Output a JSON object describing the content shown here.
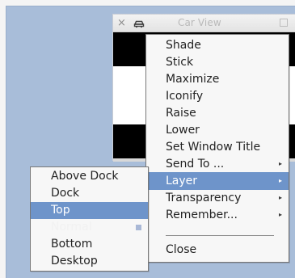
{
  "background_window": {
    "title": "Car View",
    "close_glyph": "×",
    "app_icon": "car-app-icon"
  },
  "main_menu": {
    "items": [
      {
        "label": "Shade"
      },
      {
        "label": "Stick"
      },
      {
        "label": "Maximize"
      },
      {
        "label": "Iconify"
      },
      {
        "label": "Raise"
      },
      {
        "label": "Lower"
      },
      {
        "label": "Set Window Title"
      },
      {
        "label": "Send To ...",
        "submenu_arrow": "▸"
      },
      {
        "label": "Layer",
        "submenu_arrow": "▸"
      },
      {
        "label": "Transparency",
        "submenu_arrow": "▸"
      },
      {
        "label": "Remember...",
        "submenu_arrow": "▸"
      },
      {
        "label": "Close"
      }
    ]
  },
  "layer_submenu": {
    "items": [
      {
        "label": "Above Dock"
      },
      {
        "label": "Dock"
      },
      {
        "label": "Top"
      },
      {
        "label": "Normal"
      },
      {
        "label": "Bottom"
      },
      {
        "label": "Desktop"
      }
    ]
  },
  "colors": {
    "highlight": "#6e94ca",
    "desktop": "#a8bdd9"
  },
  "icons": {
    "close": "close-icon",
    "submenu": "chevron-right-icon",
    "checked": "checked-marker-icon"
  }
}
